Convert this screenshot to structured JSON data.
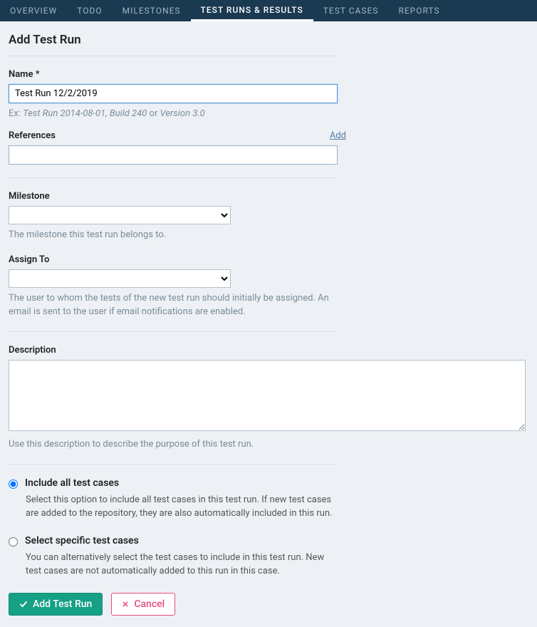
{
  "nav": {
    "items": [
      {
        "label": "OVERVIEW"
      },
      {
        "label": "TODO"
      },
      {
        "label": "MILESTONES"
      },
      {
        "label": "TEST RUNS & RESULTS"
      },
      {
        "label": "TEST CASES"
      },
      {
        "label": "REPORTS"
      }
    ]
  },
  "page": {
    "title": "Add Test Run"
  },
  "form": {
    "name": {
      "label": "Name *",
      "value": "Test Run 12/2/2019",
      "help_prefix": "Ex: ",
      "help_example": "Test Run 2014-08-01, Build 240",
      "help_middle": " or ",
      "help_example2": "Version 3.0"
    },
    "references": {
      "label": "References",
      "add_link": "Add",
      "value": ""
    },
    "milestone": {
      "label": "Milestone",
      "value": "",
      "help": "The milestone this test run belongs to."
    },
    "assign_to": {
      "label": "Assign To",
      "value": "",
      "help": "The user to whom the tests of the new test run should initially be assigned. An email is sent to the user if email notifications are enabled."
    },
    "description": {
      "label": "Description",
      "value": "",
      "help": "Use this description to describe the purpose of this test run."
    },
    "include_mode": {
      "option1": {
        "label": "Include all test cases",
        "help": "Select this option to include all test cases in this test run. If new test cases are added to the repository, they are also automatically included in this run."
      },
      "option2": {
        "label": "Select specific test cases",
        "help": "You can alternatively select the test cases to include in this test run. New test cases are not automatically added to this run in this case."
      }
    }
  },
  "buttons": {
    "submit": "Add Test Run",
    "cancel": "Cancel"
  }
}
